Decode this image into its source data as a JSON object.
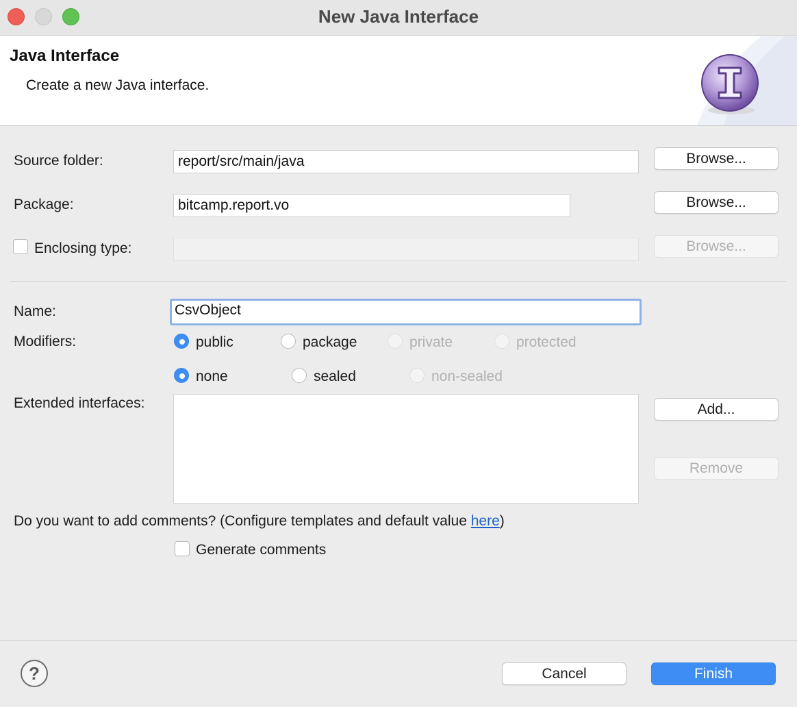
{
  "window": {
    "title": "New Java Interface"
  },
  "header": {
    "title": "Java Interface",
    "description": "Create a new Java interface.",
    "icon": "interface-icon"
  },
  "form": {
    "source_folder": {
      "label": "Source folder:",
      "value": "report/src/main/java",
      "browse_label": "Browse..."
    },
    "package": {
      "label": "Package:",
      "value": "bitcamp.report.vo",
      "browse_label": "Browse..."
    },
    "enclosing_type": {
      "label": "Enclosing type:",
      "value": "",
      "checked": false,
      "browse_label": "Browse..."
    },
    "name": {
      "label": "Name:",
      "value": "CsvObject"
    },
    "modifiers": {
      "label": "Modifiers:",
      "access": [
        {
          "label": "public",
          "selected": true,
          "enabled": true
        },
        {
          "label": "package",
          "selected": false,
          "enabled": true
        },
        {
          "label": "private",
          "selected": false,
          "enabled": false
        },
        {
          "label": "protected",
          "selected": false,
          "enabled": false
        }
      ],
      "sealing": [
        {
          "label": "none",
          "selected": true,
          "enabled": true
        },
        {
          "label": "sealed",
          "selected": false,
          "enabled": true
        },
        {
          "label": "non-sealed",
          "selected": false,
          "enabled": false
        }
      ]
    },
    "extended_interfaces": {
      "label": "Extended interfaces:",
      "add_label": "Add...",
      "remove_label": "Remove",
      "items": []
    },
    "comments": {
      "prompt_prefix": "Do you want to add comments? (Configure templates and default value ",
      "link": "here",
      "prompt_suffix": ")",
      "generate_label": "Generate comments",
      "generate_checked": false
    }
  },
  "footer": {
    "help_icon": "help-icon",
    "cancel_label": "Cancel",
    "finish_label": "Finish"
  },
  "colors": {
    "accent": "#3d8df5",
    "link": "#1f62c7",
    "focus_ring": "#8eb1e8"
  }
}
